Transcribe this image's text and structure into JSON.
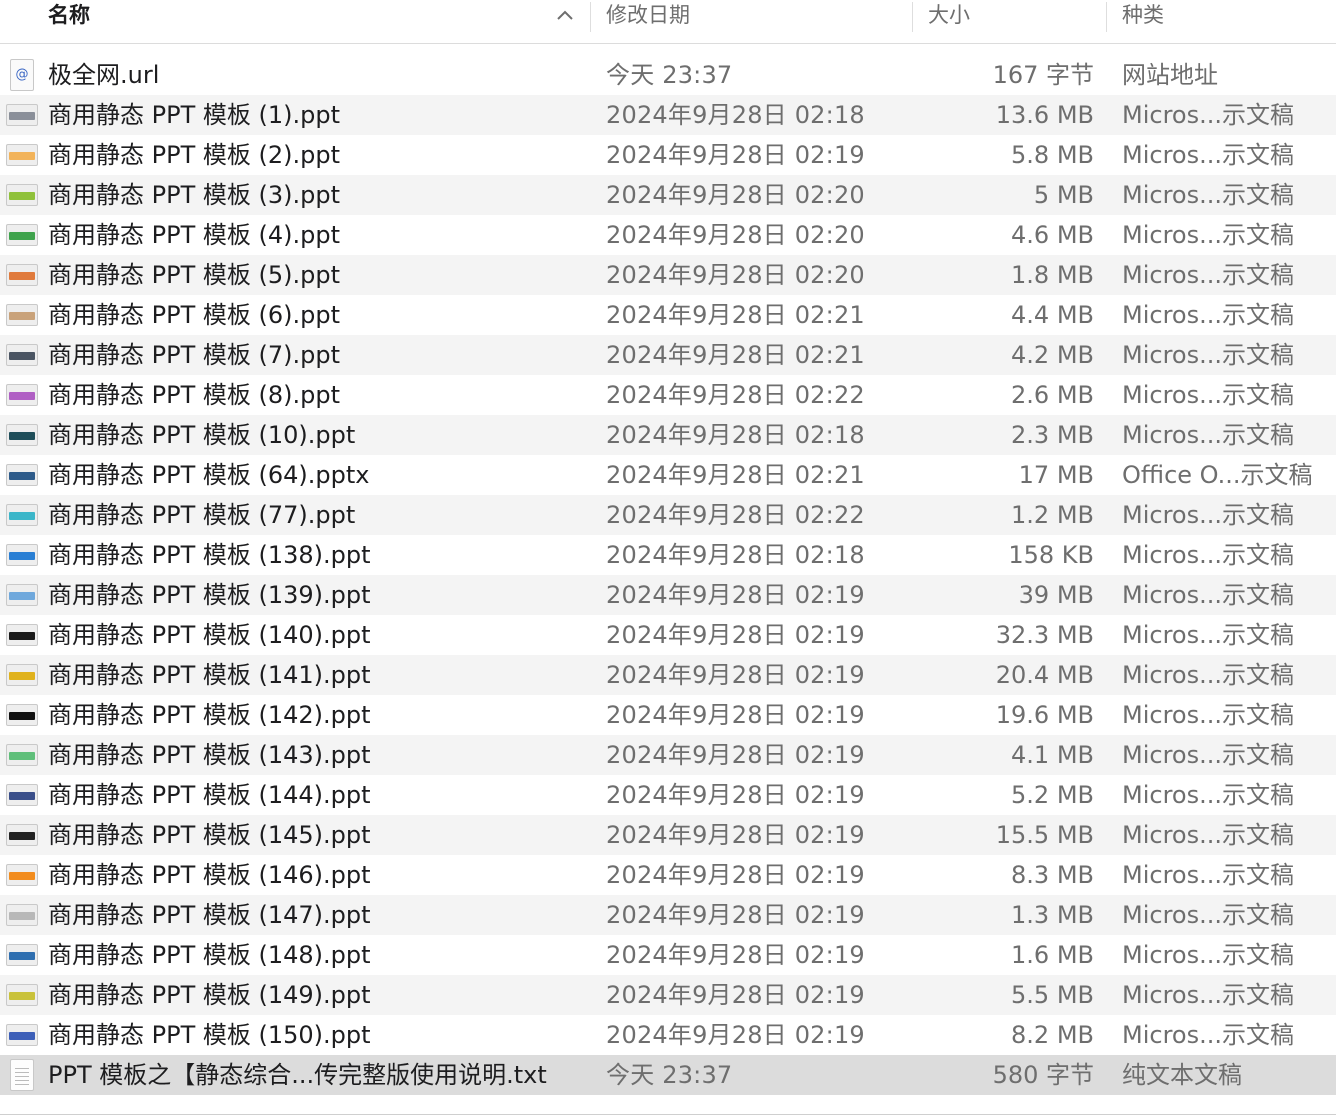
{
  "columns": {
    "name": "名称",
    "date": "修改日期",
    "size": "大小",
    "kind": "种类"
  },
  "files": [
    {
      "name": "极全网.url",
      "date": "今天 23:37",
      "size": "167 字节",
      "kind": "网站地址",
      "icon": "url-file-icon",
      "color": "#3a66c4"
    },
    {
      "name": "商用静态 PPT 模板 (1).ppt",
      "date": "2024年9月28日 02:18",
      "size": "13.6 MB",
      "kind": "Micros...示文稿",
      "icon": "ppt-thumbnail-icon",
      "color": "#8a8f99"
    },
    {
      "name": "商用静态 PPT 模板 (2).ppt",
      "date": "2024年9月28日 02:19",
      "size": "5.8 MB",
      "kind": "Micros...示文稿",
      "icon": "ppt-thumbnail-icon",
      "color": "#f2b35a"
    },
    {
      "name": "商用静态 PPT 模板 (3).ppt",
      "date": "2024年9月28日 02:20",
      "size": "5 MB",
      "kind": "Micros...示文稿",
      "icon": "ppt-thumbnail-icon",
      "color": "#8fc13a"
    },
    {
      "name": "商用静态 PPT 模板 (4).ppt",
      "date": "2024年9月28日 02:20",
      "size": "4.6 MB",
      "kind": "Micros...示文稿",
      "icon": "ppt-thumbnail-icon",
      "color": "#3fa34d"
    },
    {
      "name": "商用静态 PPT 模板 (5).ppt",
      "date": "2024年9月28日 02:20",
      "size": "1.8 MB",
      "kind": "Micros...示文稿",
      "icon": "ppt-thumbnail-icon",
      "color": "#e07a3c"
    },
    {
      "name": "商用静态 PPT 模板 (6).ppt",
      "date": "2024年9月28日 02:21",
      "size": "4.4 MB",
      "kind": "Micros...示文稿",
      "icon": "ppt-thumbnail-icon",
      "color": "#c9a27a"
    },
    {
      "name": "商用静态 PPT 模板 (7).ppt",
      "date": "2024年9月28日 02:21",
      "size": "4.2 MB",
      "kind": "Micros...示文稿",
      "icon": "ppt-thumbnail-icon",
      "color": "#4b5563"
    },
    {
      "name": "商用静态 PPT 模板 (8).ppt",
      "date": "2024年9月28日 02:22",
      "size": "2.6 MB",
      "kind": "Micros...示文稿",
      "icon": "ppt-thumbnail-icon",
      "color": "#b05fc4"
    },
    {
      "name": "商用静态 PPT 模板 (10).ppt",
      "date": "2024年9月28日 02:18",
      "size": "2.3 MB",
      "kind": "Micros...示文稿",
      "icon": "ppt-thumbnail-icon",
      "color": "#1f4e5a"
    },
    {
      "name": "商用静态 PPT 模板 (64).pptx",
      "date": "2024年9月28日 02:21",
      "size": "17 MB",
      "kind": "Office O...示文稿",
      "icon": "pptx-thumbnail-icon",
      "color": "#2e5b8a"
    },
    {
      "name": "商用静态 PPT 模板 (77).ppt",
      "date": "2024年9月28日 02:22",
      "size": "1.2 MB",
      "kind": "Micros...示文稿",
      "icon": "ppt-thumbnail-icon",
      "color": "#3bb6c9"
    },
    {
      "name": "商用静态 PPT 模板 (138).ppt",
      "date": "2024年9月28日 02:18",
      "size": "158 KB",
      "kind": "Micros...示文稿",
      "icon": "ppt-thumbnail-icon",
      "color": "#2a7fd4"
    },
    {
      "name": "商用静态 PPT 模板 (139).ppt",
      "date": "2024年9月28日 02:19",
      "size": "39 MB",
      "kind": "Micros...示文稿",
      "icon": "ppt-thumbnail-icon",
      "color": "#6fa8dc"
    },
    {
      "name": "商用静态 PPT 模板 (140).ppt",
      "date": "2024年9月28日 02:19",
      "size": "32.3 MB",
      "kind": "Micros...示文稿",
      "icon": "ppt-thumbnail-icon",
      "color": "#1a1a1a"
    },
    {
      "name": "商用静态 PPT 模板 (141).ppt",
      "date": "2024年9月28日 02:19",
      "size": "20.4 MB",
      "kind": "Micros...示文稿",
      "icon": "ppt-thumbnail-icon",
      "color": "#e0b21c"
    },
    {
      "name": "商用静态 PPT 模板 (142).ppt",
      "date": "2024年9月28日 02:19",
      "size": "19.6 MB",
      "kind": "Micros...示文稿",
      "icon": "ppt-thumbnail-icon",
      "color": "#111111"
    },
    {
      "name": "商用静态 PPT 模板 (143).ppt",
      "date": "2024年9月28日 02:19",
      "size": "4.1 MB",
      "kind": "Micros...示文稿",
      "icon": "ppt-thumbnail-icon",
      "color": "#5fbf7a"
    },
    {
      "name": "商用静态 PPT 模板 (144).ppt",
      "date": "2024年9月28日 02:19",
      "size": "5.2 MB",
      "kind": "Micros...示文稿",
      "icon": "ppt-thumbnail-icon",
      "color": "#3a4f8a"
    },
    {
      "name": "商用静态 PPT 模板 (145).ppt",
      "date": "2024年9月28日 02:19",
      "size": "15.5 MB",
      "kind": "Micros...示文稿",
      "icon": "ppt-thumbnail-icon",
      "color": "#222222"
    },
    {
      "name": "商用静态 PPT 模板 (146).ppt",
      "date": "2024年9月28日 02:19",
      "size": "8.3 MB",
      "kind": "Micros...示文稿",
      "icon": "ppt-thumbnail-icon",
      "color": "#f28c1e"
    },
    {
      "name": "商用静态 PPT 模板 (147).ppt",
      "date": "2024年9月28日 02:19",
      "size": "1.3 MB",
      "kind": "Micros...示文稿",
      "icon": "ppt-thumbnail-icon",
      "color": "#b8b8b8"
    },
    {
      "name": "商用静态 PPT 模板 (148).ppt",
      "date": "2024年9月28日 02:19",
      "size": "1.6 MB",
      "kind": "Micros...示文稿",
      "icon": "ppt-thumbnail-icon",
      "color": "#2f6fb0"
    },
    {
      "name": "商用静态 PPT 模板 (149).ppt",
      "date": "2024年9月28日 02:19",
      "size": "5.5 MB",
      "kind": "Micros...示文稿",
      "icon": "ppt-thumbnail-icon",
      "color": "#c9c23a"
    },
    {
      "name": "商用静态 PPT 模板 (150).ppt",
      "date": "2024年9月28日 02:19",
      "size": "8.2 MB",
      "kind": "Micros...示文稿",
      "icon": "ppt-thumbnail-icon",
      "color": "#3d5fb8"
    },
    {
      "name": "PPT 模板之【静态综合...传完整版使用说明.txt",
      "date": "今天 23:37",
      "size": "580 字节",
      "kind": "纯文本文稿",
      "icon": "text-file-icon",
      "color": "#bbbbbb",
      "selected": true
    }
  ]
}
